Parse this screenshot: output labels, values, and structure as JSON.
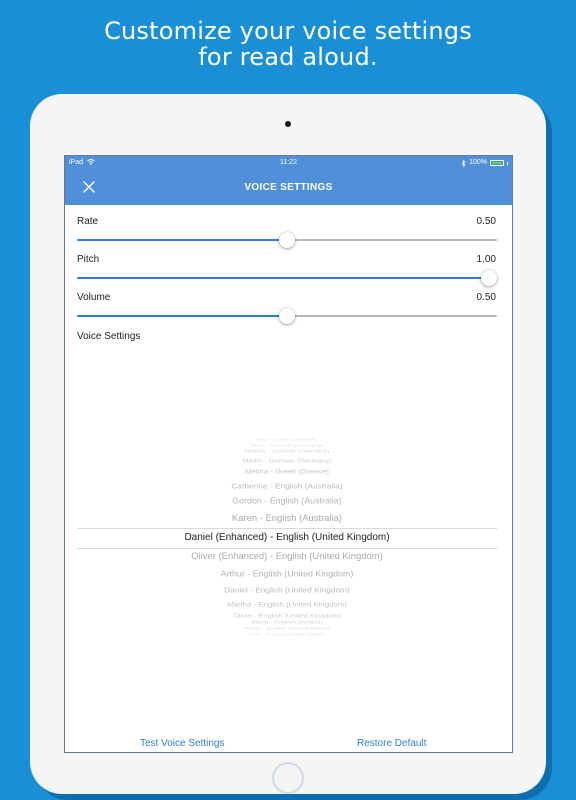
{
  "headline": {
    "line1": "Customize your voice settings",
    "line2": "for read aloud."
  },
  "statusbar": {
    "device": "iPad",
    "time": "11:22",
    "battery": "100%",
    "battery_level": 1.0
  },
  "nav": {
    "title": "VOICE SETTINGS",
    "close_icon": "close-x-icon"
  },
  "rate": {
    "label": "Rate",
    "value_text": "0.50",
    "value": 0.5
  },
  "pitch": {
    "label": "Pitch",
    "value_text": "1.00",
    "value": 1.0
  },
  "volume": {
    "label": "Volume",
    "value_text": "0.50",
    "value": 0.5
  },
  "voice_section_label": "Voice Settings",
  "voices": {
    "selected": "Daniel (Enhanced) - English (United Kingdom)",
    "items": [
      "Sara - Danish (Denmark)",
      "Anna - German (Germany)",
      "Helena - German (Germany)",
      "Martin - German (Germany)",
      "Melina - Greek (Greece)",
      "Catherine - English (Australia)",
      "Gordon - English (Australia)",
      "Karen - English (Australia)",
      "Daniel (Enhanced) - English (United Kingdom)",
      "Oliver (Enhanced) - English (United Kingdom)",
      "Arthur - English (United Kingdom)",
      "Daniel - English (United Kingdom)",
      "Martha - English (United Kingdom)",
      "Oliver - English (United Kingdom)",
      "Moira - English (Ireland)",
      "Aaron - English (United States)",
      "Fred - English (United States)"
    ]
  },
  "footer": {
    "test_label": "Test Voice Settings",
    "restore_label": "Restore Default"
  },
  "colors": {
    "background": "#1b8fd6",
    "navbar": "#4f90d9",
    "accent": "#2d7ed8"
  }
}
